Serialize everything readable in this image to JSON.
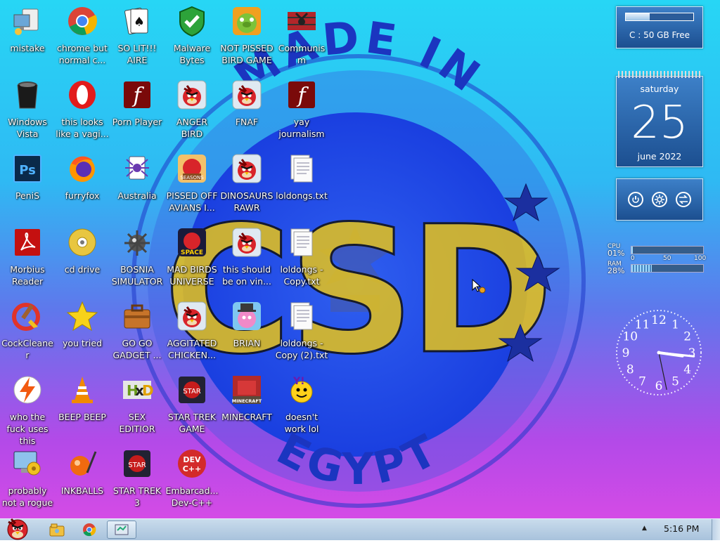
{
  "desktop": {
    "wallpaper": {
      "top_text": "MADE IN",
      "bottom_text": "EGYPT",
      "center_text": "CSD",
      "colors": {
        "outer_ring": "#2d55d4",
        "inner_disc": "#1a3fe0",
        "letters_yellow": "#e7c31a",
        "letters_green": "#66b83a",
        "letters_black": "#111111",
        "stars": "#1b2f9f"
      }
    },
    "icons": [
      {
        "label": "mistake",
        "icon": "computer-icon"
      },
      {
        "label": "chrome but normal c...",
        "icon": "chrome-icon"
      },
      {
        "label": "SO LIT!!! AIRE",
        "icon": "solitaire-icon"
      },
      {
        "label": "Malware Bytes",
        "icon": "shield-icon"
      },
      {
        "label": "NOT PISSED BIRD GAME",
        "icon": "green-pig-icon"
      },
      {
        "label": "Communism",
        "icon": "emblem-icon"
      },
      {
        "label": "Windows Vista",
        "icon": "bin-icon"
      },
      {
        "label": "this looks like a vagi...",
        "icon": "opera-icon"
      },
      {
        "label": "Porn Player",
        "icon": "flash-icon"
      },
      {
        "label": "ANGER BIRD",
        "icon": "angry-bird-icon"
      },
      {
        "label": "FNAF",
        "icon": "angry-bird-icon"
      },
      {
        "label": "yay journalism",
        "icon": "flash-icon"
      },
      {
        "label": "PeniS",
        "icon": "photoshop-icon"
      },
      {
        "label": "furryfox",
        "icon": "firefox-icon"
      },
      {
        "label": "Australia",
        "icon": "spider-solitaire-icon"
      },
      {
        "label": "PISSED OFF AVIANS I...",
        "icon": "angry-birds-seasons-icon"
      },
      {
        "label": "DINOSAURS RAWR",
        "icon": "angry-bird-icon"
      },
      {
        "label": "loldongs.txt",
        "icon": "text-file-icon"
      },
      {
        "label": "Morbius Reader",
        "icon": "acrobat-icon"
      },
      {
        "label": "cd drive",
        "icon": "cd-icon"
      },
      {
        "label": "BOSNIA SIMULATOR",
        "icon": "mine-icon"
      },
      {
        "label": "MAD BIRDS UNIVERSE",
        "icon": "angry-birds-space-icon"
      },
      {
        "label": "this should be on vin...",
        "icon": "angry-bird-icon"
      },
      {
        "label": "loldongs - Copy.txt",
        "icon": "text-file-icon"
      },
      {
        "label": "CockCleaner",
        "icon": "ccleaner-icon"
      },
      {
        "label": "you tried",
        "icon": "star-icon"
      },
      {
        "label": "GO GO GADGET ...",
        "icon": "briefcase-icon"
      },
      {
        "label": "AGGITATED CHICKEN...",
        "icon": "angry-bird-icon"
      },
      {
        "label": "BRIAN",
        "icon": "pink-bird-icon"
      },
      {
        "label": "loldongs - Copy (2).txt",
        "icon": "text-file-icon"
      },
      {
        "label": "who the fuck uses this",
        "icon": "winamp-bolt-icon"
      },
      {
        "label": "BEEP BEEP",
        "icon": "vlc-cone-icon"
      },
      {
        "label": "SEX EDITIOR",
        "icon": "hxd-icon"
      },
      {
        "label": "STAR TREK GAME",
        "icon": "angry-birds-star-wars-icon"
      },
      {
        "label": "MINECRAFT",
        "icon": "minecraft-icon"
      },
      {
        "label": "doesn't work lol",
        "icon": "yahoo-icon"
      },
      {
        "label": "probably not a rogue",
        "icon": "monitor-gears-icon"
      },
      {
        "label": "INKBALLS",
        "icon": "inkball-icon"
      },
      {
        "label": "STAR TREK 3",
        "icon": "angry-birds-star-wars-icon"
      },
      {
        "label": "Embarcad... Dev-C++",
        "icon": "devcpp-icon"
      }
    ]
  },
  "gadgets": {
    "drive": {
      "label": "C : 50 GB Free",
      "used_fraction": 0.35
    },
    "calendar": {
      "weekday": "saturday",
      "day": "25",
      "month_year": "june 2022"
    },
    "controls": {
      "icons": [
        "power-icon",
        "gear-icon",
        "switch-icon"
      ]
    },
    "meter": {
      "cpu_label": "CPU",
      "cpu_value": "01%",
      "ram_label": "RAM",
      "ram_value": "28%",
      "scale_0": "0",
      "scale_50": "50",
      "scale_100": "100",
      "cpu_fraction": 0.01,
      "ram_fraction": 0.28
    },
    "clock": {
      "hour": 3,
      "minute": 16,
      "second": 28,
      "numbers": [
        "12",
        "1",
        "2",
        "3",
        "4",
        "5",
        "6",
        "7",
        "8",
        "9",
        "10",
        "11"
      ]
    }
  },
  "taskbar": {
    "start_icon": "angry-bird-start-icon",
    "pinned": [
      "explorer-icon",
      "chrome-icon",
      "window-app-icon"
    ],
    "tray_arrow": "▲",
    "time": "5:16 PM"
  }
}
